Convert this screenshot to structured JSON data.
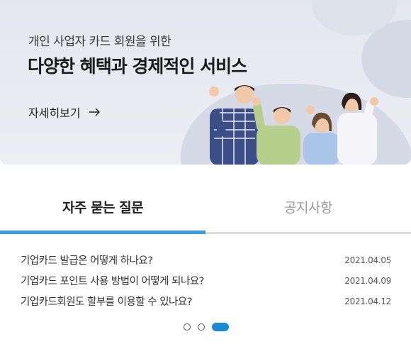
{
  "banner": {
    "subtitle": "개인 사업자 카드 회원을 위한",
    "title": "다양한 혜택과 경제적인 서비스",
    "more_label": "자세히보기"
  },
  "tabs": [
    {
      "label": "자주 묻는 질문",
      "active": true
    },
    {
      "label": "공지사항",
      "active": false
    }
  ],
  "faq": [
    {
      "question": "기업카드 발급은 어떻게 하나요?",
      "date": "2021.04.05"
    },
    {
      "question": "기업카드 포인트 사용 방법이 어떻게 되나요?",
      "date": "2021.04.09"
    },
    {
      "question": "기업카드회원도 할부를 이용할 수 있나요?",
      "date": "2021.04.12"
    }
  ],
  "pager": {
    "total": 3,
    "current": 3
  },
  "colors": {
    "accent": "#3d9ee0",
    "pager_active": "#1a8ad6",
    "banner_bg": "#e6e9f0"
  }
}
